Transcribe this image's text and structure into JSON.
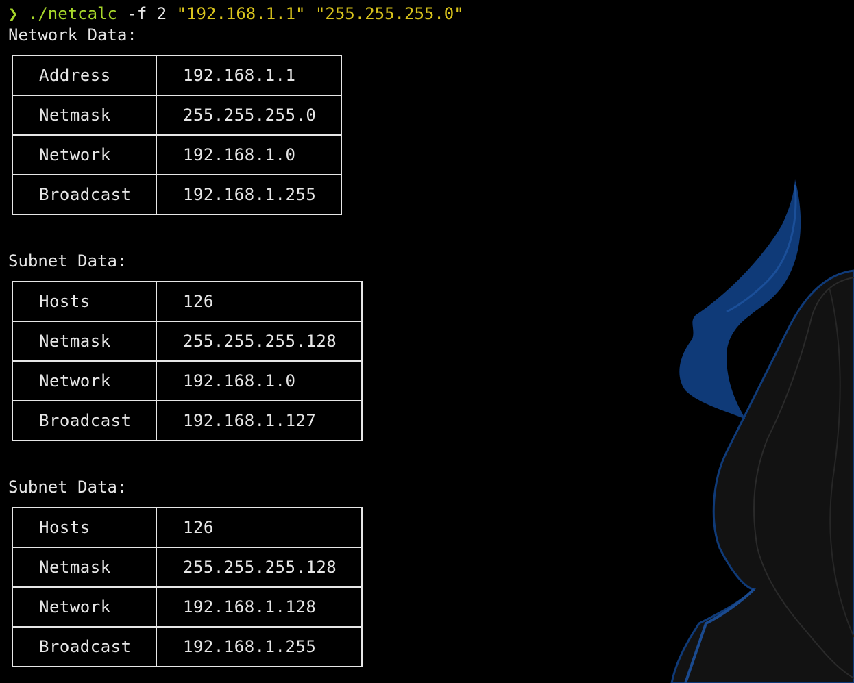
{
  "theme": {
    "background": "#000000",
    "foreground": "#e6e6e6",
    "green": "#a6d62a",
    "yellow": "#d9c41d",
    "art_blue": "#0f3a78"
  },
  "prompt": {
    "symbol": "❯",
    "command": "./netcalc",
    "flag": " -f 2 ",
    "arg1": "\"192.168.1.1\"",
    "arg2": "\"255.255.255.0\""
  },
  "network_section": {
    "label": "Network Data:",
    "rows": [
      {
        "key": "Address",
        "value": "192.168.1.1"
      },
      {
        "key": "Netmask",
        "value": "255.255.255.0"
      },
      {
        "key": "Network",
        "value": "192.168.1.0"
      },
      {
        "key": "Broadcast",
        "value": "192.168.1.255"
      }
    ]
  },
  "subnets": [
    {
      "label": "Subnet Data:",
      "rows": [
        {
          "key": "Hosts",
          "value": "126"
        },
        {
          "key": "Netmask",
          "value": "255.255.255.128"
        },
        {
          "key": "Network",
          "value": "192.168.1.0"
        },
        {
          "key": "Broadcast",
          "value": "192.168.1.127"
        }
      ]
    },
    {
      "label": "Subnet Data:",
      "rows": [
        {
          "key": "Hosts",
          "value": "126"
        },
        {
          "key": "Netmask",
          "value": "255.255.255.128"
        },
        {
          "key": "Network",
          "value": "192.168.1.128"
        },
        {
          "key": "Broadcast",
          "value": "192.168.1.255"
        }
      ]
    }
  ]
}
